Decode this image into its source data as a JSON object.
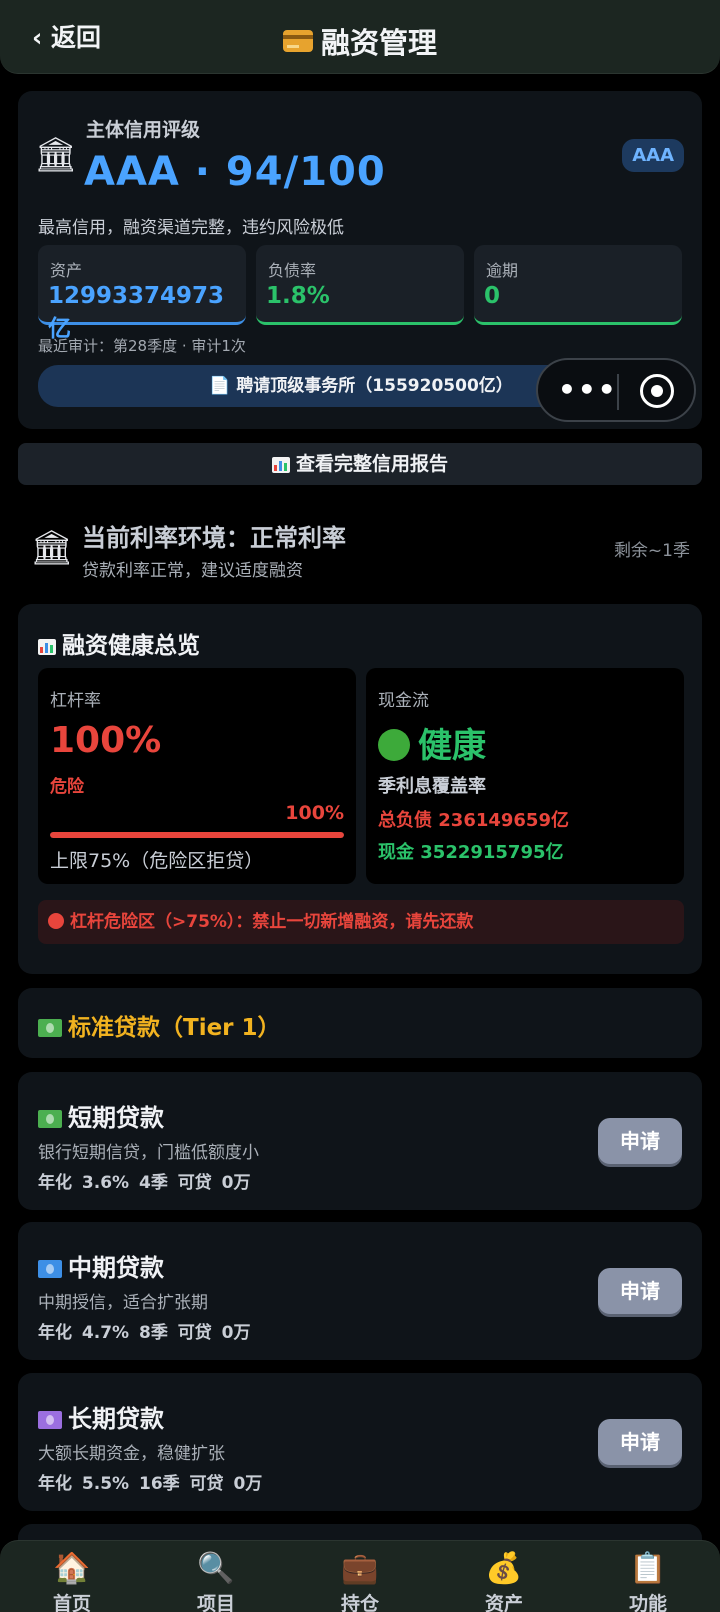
{
  "header": {
    "back_label": "‹ 返回",
    "title": "融资管理",
    "title_icon": "credit-card-icon"
  },
  "credit": {
    "icon": "bank-icon",
    "label": "主体信用评级",
    "rating_line": "AAA · 94/100",
    "badge": "AAA",
    "description": "最高信用，融资渠道完整，违约风险极低",
    "stats": [
      {
        "label": "资产",
        "value": "12993374973亿",
        "color": "#4aa3ff"
      },
      {
        "label": "负债率",
        "value": "1.8%",
        "color": "#2bc26a"
      },
      {
        "label": "逾期",
        "value": "0",
        "color": "#2bc26a"
      }
    ],
    "audit_line": "最近审计：第28季度 · 审计1次",
    "hire_button": "聘请顶级事务所（155920500亿）"
  },
  "mini_program": {
    "more_icon": "more-dots-icon",
    "close_icon": "target-close-icon"
  },
  "report_button": "查看完整信用报告",
  "rate_env": {
    "icon": "bank-icon",
    "title": "当前利率环境：正常利率",
    "subtitle": "贷款利率正常，建议适度融资",
    "remaining": "剩余~1季"
  },
  "health": {
    "title": "融资健康总览",
    "leverage": {
      "label": "杠杆率",
      "value": "100%",
      "status": "危险",
      "bar_pct_label": "100%",
      "bar_fraction": 1.0,
      "limit_text": "上限75%（危险区拒贷）"
    },
    "cashflow": {
      "label": "现金流",
      "status": "健康",
      "coverage_label": "季利息覆盖率",
      "total_debt": "总负债 236149659亿",
      "cash": "现金 3522915795亿"
    },
    "warning": "杠杆危险区（>75%）：禁止一切新增融资，请先还款"
  },
  "tier": {
    "title": "标准贷款（Tier 1）",
    "icon": "money-green-icon"
  },
  "loans": [
    {
      "title": "短期贷款",
      "description": "银行短期信贷，门槛低额度小",
      "terms": "年化 3.6%  4季  可贷 0万",
      "apply_label": "申请",
      "icon": "money-green-icon",
      "icon_color": "#4caf50"
    },
    {
      "title": "中期贷款",
      "description": "中期授信，适合扩张期",
      "terms": "年化 4.7%  8季  可贷 0万",
      "apply_label": "申请",
      "icon": "money-blue-icon",
      "icon_color": "#3d8fe6"
    },
    {
      "title": "长期贷款",
      "description": "大额长期资金，稳健扩张",
      "terms": "年化 5.5%  16季  可贷 0万",
      "apply_label": "申请",
      "icon": "money-purple-icon",
      "icon_color": "#9b6fe0"
    }
  ],
  "nav": [
    {
      "label": "首页",
      "icon": "house-icon"
    },
    {
      "label": "项目",
      "icon": "magnifier-icon"
    },
    {
      "label": "持仓",
      "icon": "briefcase-icon"
    },
    {
      "label": "资产",
      "icon": "money-bag-icon"
    },
    {
      "label": "功能",
      "icon": "clipboard-icon"
    }
  ]
}
